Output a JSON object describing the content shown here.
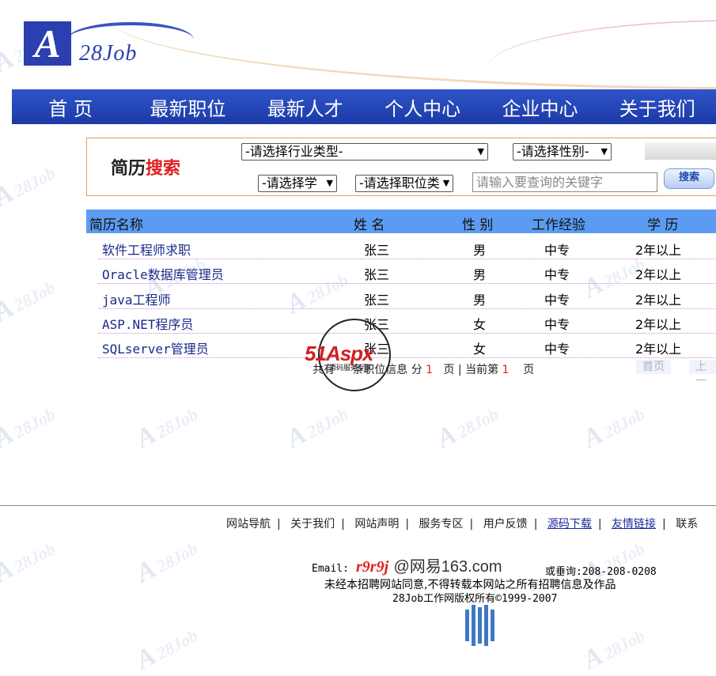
{
  "brand": {
    "logo_letter": "A",
    "logo_text": "28Job"
  },
  "nav": [
    "首 页",
    "最新职位",
    "最新人才",
    "个人中心",
    "企业中心",
    "关于我们"
  ],
  "search": {
    "title_left": "简历",
    "title_right": "搜索",
    "industry": "-请选择行业类型-",
    "gender": "-请选择性别-",
    "education": "-请选择学",
    "position": "-请选择职位类",
    "keyword_placeholder": "请输入要查询的关键字",
    "button": "搜索"
  },
  "table": {
    "headers": [
      "简历名称",
      "姓 名",
      "性 别",
      "工作经验",
      "学 历"
    ],
    "rows": [
      [
        "软件工程师求职",
        "张三",
        "男",
        "中专",
        "2年以上"
      ],
      [
        "Oracle数据库管理员",
        "张三",
        "男",
        "中专",
        "2年以上"
      ],
      [
        "java工程师",
        "张三",
        "男",
        "中专",
        "2年以上"
      ],
      [
        "ASP.NET程序员",
        "张三",
        "女",
        "中专",
        "2年以上"
      ],
      [
        "SQLserver管理员",
        "张三",
        "女",
        "中专",
        "2年以上"
      ]
    ]
  },
  "pager": {
    "prefix": "共有",
    "mid": "条职位信息 分",
    "pages": "1",
    "page_unit": "页 | 当前第",
    "current": "1",
    "suffix": "页",
    "first": "首页",
    "prev": "上一"
  },
  "stamp": {
    "text_main": "51Aspx",
    "text_green": "",
    "sub": "源码服务专家"
  },
  "footer": {
    "links": [
      "网站导航",
      "关于我们",
      "网站声明",
      "服务专区",
      "用户反馈",
      "源码下载",
      "友情链接",
      "联系"
    ],
    "email_label": "Email:",
    "email_user": "r9r9j",
    "email_domain": "@网易163.com",
    "phone": "或垂询:208-208-0208",
    "notice": "未经本招聘网站同意,不得转载本网站之所有招聘信息及作品",
    "copyright": "28Job工作网版权所有©1999-2007"
  }
}
